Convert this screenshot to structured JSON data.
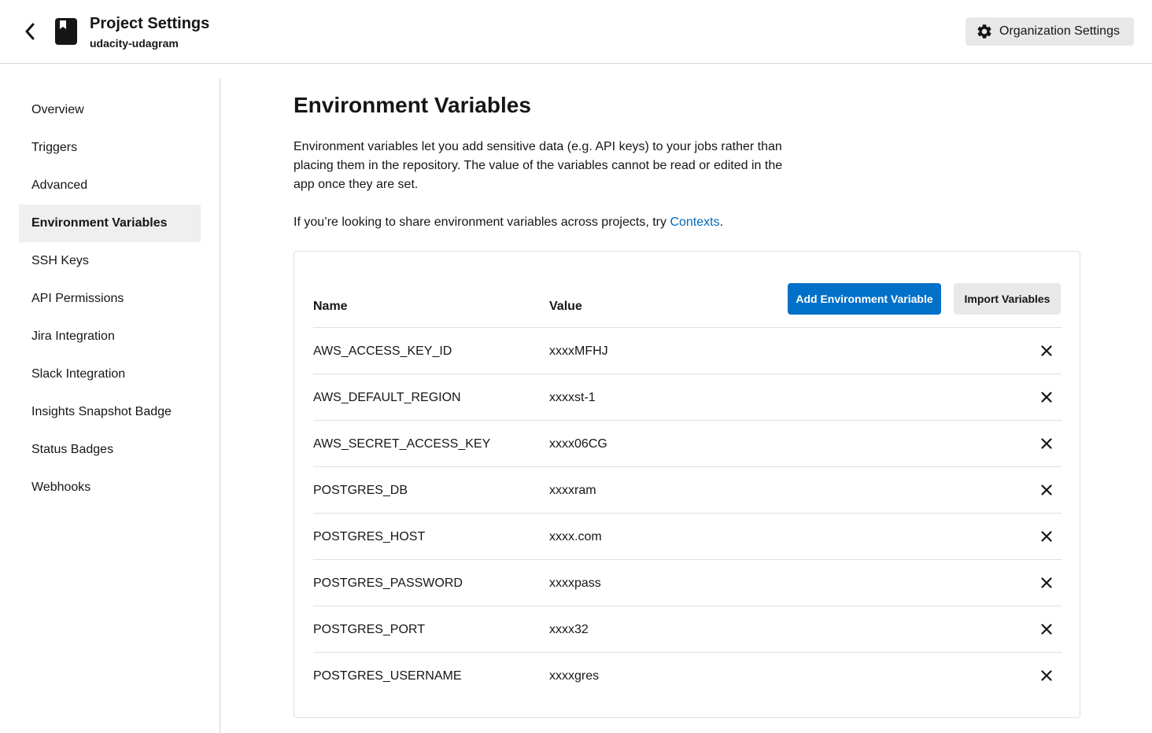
{
  "header": {
    "title": "Project Settings",
    "project_name": "udacity-udagram",
    "org_settings_label": "Organization Settings",
    "back_icon": "chevron-left-icon",
    "project_icon": "repo-bookmark-icon",
    "org_icon": "gear-icon"
  },
  "sidebar": {
    "items": [
      {
        "label": "Overview",
        "active": false
      },
      {
        "label": "Triggers",
        "active": false
      },
      {
        "label": "Advanced",
        "active": false
      },
      {
        "label": "Environment Variables",
        "active": true
      },
      {
        "label": "SSH Keys",
        "active": false
      },
      {
        "label": "API Permissions",
        "active": false
      },
      {
        "label": "Jira Integration",
        "active": false
      },
      {
        "label": "Slack Integration",
        "active": false
      },
      {
        "label": "Insights Snapshot Badge",
        "active": false
      },
      {
        "label": "Status Badges",
        "active": false
      },
      {
        "label": "Webhooks",
        "active": false
      }
    ]
  },
  "main": {
    "title": "Environment Variables",
    "description": "Environment variables let you add sensitive data (e.g. API keys) to your jobs rather than placing them in the repository. The value of the variables cannot be read or edited in the app once they are set.",
    "share_prefix": "If you’re looking to share environment variables across projects, try ",
    "share_link": "Contexts",
    "share_suffix": "."
  },
  "table": {
    "col_name": "Name",
    "col_value": "Value",
    "add_button": "Add Environment Variable",
    "import_button": "Import Variables",
    "delete_icon": "close-icon",
    "rows": [
      {
        "name": "AWS_ACCESS_KEY_ID",
        "value": "xxxxMFHJ"
      },
      {
        "name": "AWS_DEFAULT_REGION",
        "value": "xxxxst-1"
      },
      {
        "name": "AWS_SECRET_ACCESS_KEY",
        "value": "xxxx06CG"
      },
      {
        "name": "POSTGRES_DB",
        "value": "xxxxram"
      },
      {
        "name": "POSTGRES_HOST",
        "value": "xxxx.com"
      },
      {
        "name": "POSTGRES_PASSWORD",
        "value": "xxxxpass"
      },
      {
        "name": "POSTGRES_PORT",
        "value": "xxxx32"
      },
      {
        "name": "POSTGRES_USERNAME",
        "value": "xxxxgres"
      }
    ]
  },
  "colors": {
    "accent": "#0070c8",
    "link": "#0068b8",
    "active_nav_bg": "#efefef"
  }
}
